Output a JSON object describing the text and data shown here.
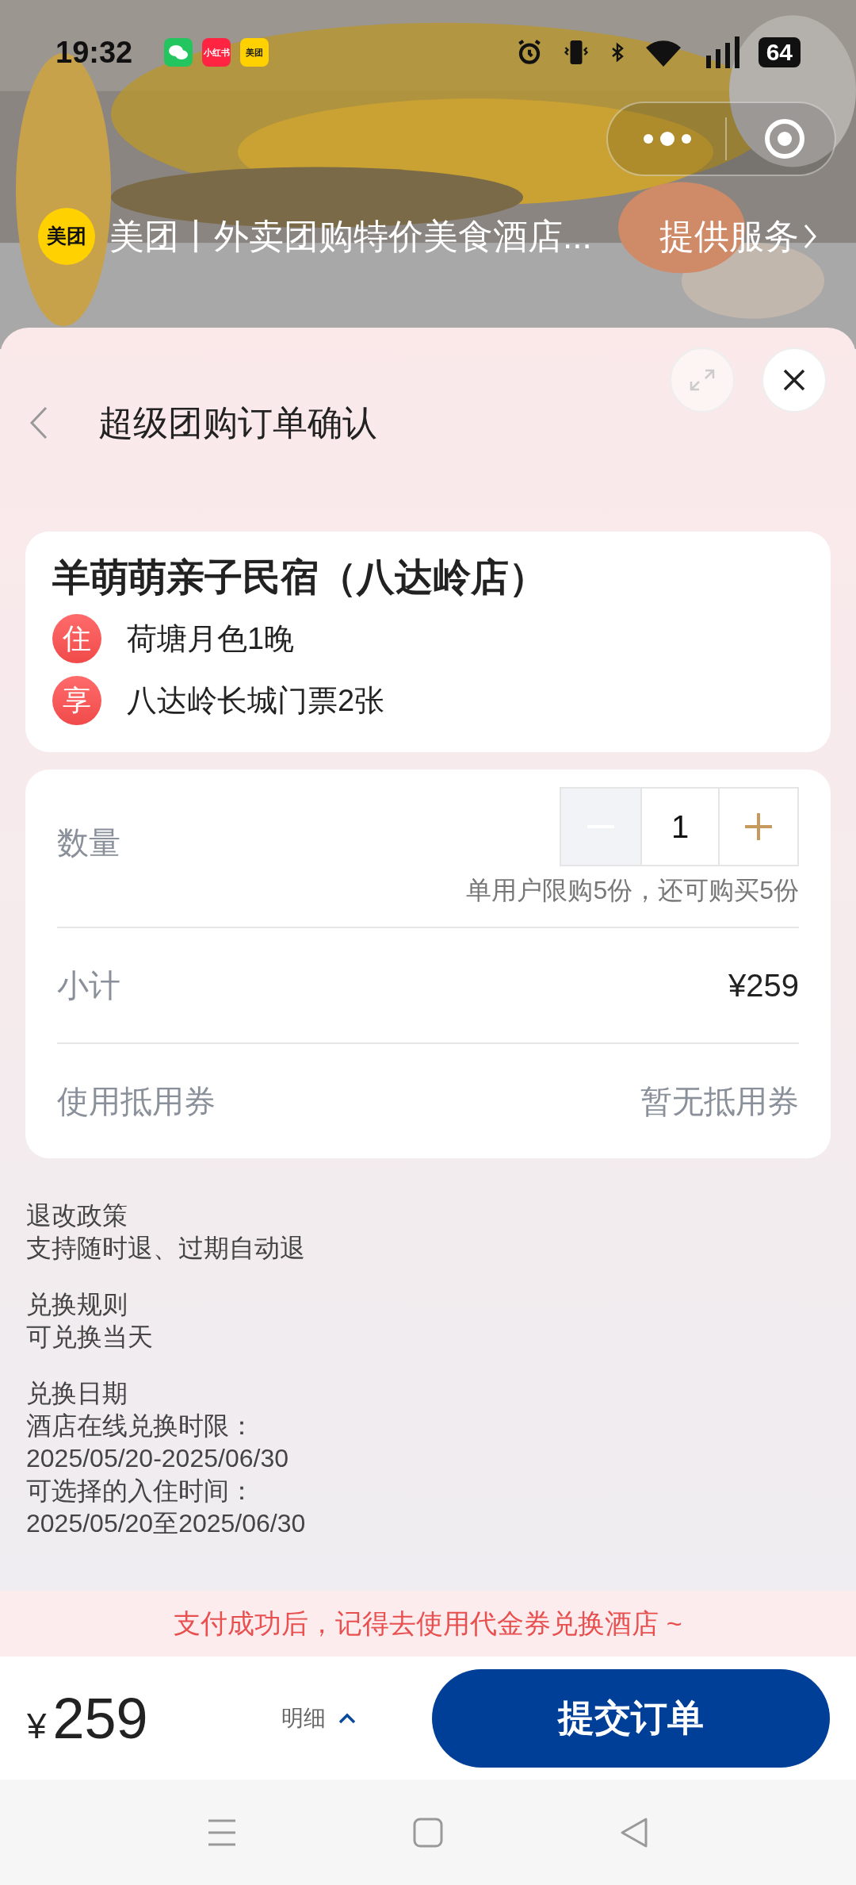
{
  "status_bar": {
    "time": "19:32",
    "apps": [
      {
        "label": "小红书",
        "color": "#ff2442"
      },
      {
        "label": "美团",
        "color": "#ffd100"
      }
    ],
    "battery": "64"
  },
  "mini_program": {
    "logo": "美团",
    "title": "美团丨外卖团购特价美食酒店...",
    "service": "提供服务"
  },
  "header": {
    "title": "超级团购订单确认"
  },
  "hotel": {
    "name": "羊萌萌亲子民宿（八达岭店）",
    "items": [
      {
        "badge": "住",
        "text": "荷塘月色1晚"
      },
      {
        "badge": "享",
        "text": "八达岭长城门票2张"
      }
    ]
  },
  "order": {
    "quantity_label": "数量",
    "quantity": "1",
    "minus_disabled": true,
    "limit": "单用户限购5份，还可购买5份",
    "subtotal_label": "小计",
    "subtotal": "¥259",
    "coupon_label": "使用抵用券",
    "coupon": "暂无抵用券"
  },
  "policies": [
    {
      "title": "退改政策",
      "lines": [
        "支持随时退、过期自动退"
      ]
    },
    {
      "title": "兑换规则",
      "lines": [
        "可兑换当天"
      ]
    },
    {
      "title": "兑换日期",
      "lines": [
        "酒店在线兑换时限：",
        "2025/05/20-2025/06/30",
        "可选择的入住时间：",
        "2025/05/20至2025/06/30"
      ]
    }
  ],
  "notice": "支付成功后，记得去使用代金券兑换酒店 ~",
  "footer": {
    "currency": "¥",
    "total": "259",
    "detail": "明细",
    "submit": "提交订单"
  }
}
